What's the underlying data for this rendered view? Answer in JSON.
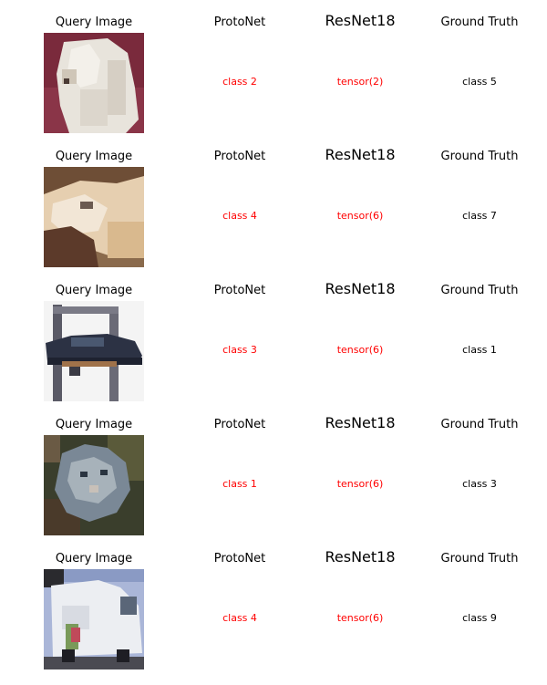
{
  "headers": {
    "query": "Query Image",
    "protonet": "ProtoNet",
    "resnet": "ResNet18",
    "ground_truth": "Ground Truth"
  },
  "colors": {
    "wrong_prediction": "#ff0000",
    "ground_truth_text": "#000000"
  },
  "rows": [
    {
      "image": "white-dog",
      "protonet": "class 2",
      "resnet": "tensor(2)",
      "ground_truth": "class 5"
    },
    {
      "image": "horse-head",
      "protonet": "class 4",
      "resnet": "tensor(6)",
      "ground_truth": "class 7"
    },
    {
      "image": "car-on-lift",
      "protonet": "class 3",
      "resnet": "tensor(6)",
      "ground_truth": "class 1"
    },
    {
      "image": "cat-face",
      "protonet": "class 1",
      "resnet": "tensor(6)",
      "ground_truth": "class 3"
    },
    {
      "image": "white-truck",
      "protonet": "class 4",
      "resnet": "tensor(6)",
      "ground_truth": "class 9"
    }
  ]
}
